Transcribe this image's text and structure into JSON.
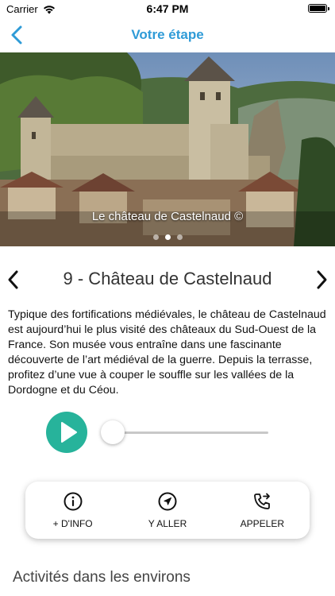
{
  "status_bar": {
    "carrier": "Carrier",
    "time": "6:47 PM",
    "battery_level": 1.0
  },
  "nav": {
    "title": "Votre étape",
    "back_icon": "chevron-left-icon"
  },
  "hero": {
    "caption": "Le château de Castelnaud ©",
    "page_count": 3,
    "active_page": 2
  },
  "stage": {
    "title": "9 - Château de Castelnaud",
    "prev_icon": "chevron-left-icon",
    "next_icon": "chevron-right-icon"
  },
  "description": "Typique des fortifications médiévales, le château de Castelnaud est aujourd’hui le plus visité des châteaux du Sud-Ouest de la France. Son musée vous entraîne dans une fascinante découverte de l’art médiéval de la guerre. Depuis la terrasse, profitez d’une vue à couper le souffle sur les vallées de la Dordogne et du Céou.",
  "player": {
    "progress": 0.0,
    "play_color": "#27b39b"
  },
  "actions": [
    {
      "label": "+ D'INFO",
      "icon": "info-icon"
    },
    {
      "label": "Y ALLER",
      "icon": "navigation-arrow-icon"
    },
    {
      "label": "APPELER",
      "icon": "phone-forward-icon"
    }
  ],
  "section": {
    "heading": "Activités dans les environs"
  },
  "colors": {
    "accent": "#2f9bd7",
    "play": "#27b39b"
  }
}
